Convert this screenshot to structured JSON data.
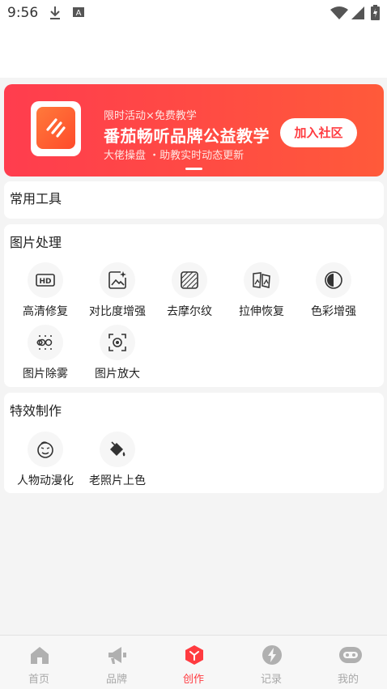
{
  "status_bar": {
    "time": "9:56",
    "icons": [
      "download-icon",
      "font-a-icon",
      "wifi-icon",
      "signal-icon",
      "battery-charging-icon"
    ]
  },
  "banner": {
    "subtitle": "限时活动×免费教学",
    "title": "番茄畅听品牌公益教学",
    "description": "大佬操盘 ・助教实时动态更新",
    "button_label": "加入社区",
    "logo_icon": "fanqie-logo-icon"
  },
  "sections": {
    "common_tools": {
      "title": "常用工具"
    },
    "image_processing": {
      "title": "图片处理",
      "tools": [
        {
          "label": "高清修复",
          "icon": "hd-icon"
        },
        {
          "label": "对比度增强",
          "icon": "image-sparkle-icon"
        },
        {
          "label": "去摩尔纹",
          "icon": "moire-icon"
        },
        {
          "label": "拉伸恢复",
          "icon": "stretch-image-icon"
        },
        {
          "label": "色彩增强",
          "icon": "contrast-half-circle-icon"
        },
        {
          "label": "图片除雾",
          "icon": "defog-icon"
        },
        {
          "label": "图片放大",
          "icon": "scan-zoom-icon"
        }
      ]
    },
    "effects": {
      "title": "特效制作",
      "tools": [
        {
          "label": "人物动漫化",
          "icon": "cartoon-face-icon"
        },
        {
          "label": "老照片上色",
          "icon": "paint-bucket-icon"
        }
      ]
    }
  },
  "bottom_nav": {
    "items": [
      {
        "label": "首页",
        "icon": "home-icon",
        "active": false
      },
      {
        "label": "品牌",
        "icon": "megaphone-icon",
        "active": false
      },
      {
        "label": "创作",
        "icon": "create-cube-icon",
        "active": true
      },
      {
        "label": "记录",
        "icon": "lightning-icon",
        "active": false
      },
      {
        "label": "我的",
        "icon": "robot-face-icon",
        "active": false
      }
    ]
  },
  "colors": {
    "accent": "#ff3b40",
    "banner_gradient_start": "#ff3d4e",
    "banner_gradient_end": "#ff5a3a",
    "nav_inactive": "#a8a8a8"
  }
}
